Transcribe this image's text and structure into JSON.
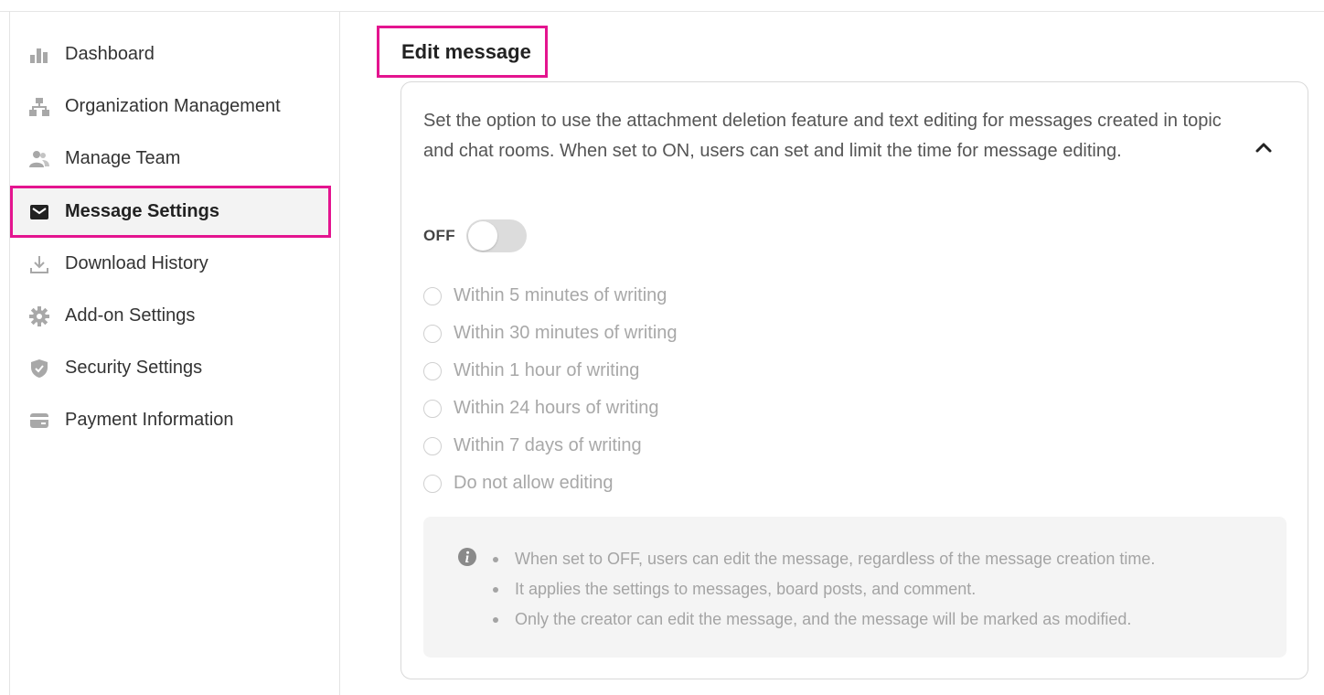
{
  "sidebar": {
    "items": [
      {
        "label": "Dashboard",
        "icon": "bar-chart-icon",
        "active": false
      },
      {
        "label": "Organization Management",
        "icon": "org-chart-icon",
        "active": false
      },
      {
        "label": "Manage Team",
        "icon": "team-icon",
        "active": false
      },
      {
        "label": "Message Settings",
        "icon": "envelope-icon",
        "active": true
      },
      {
        "label": "Download History",
        "icon": "download-icon",
        "active": false
      },
      {
        "label": "Add-on Settings",
        "icon": "gear-icon",
        "active": false
      },
      {
        "label": "Security Settings",
        "icon": "shield-icon",
        "active": false
      },
      {
        "label": "Payment Information",
        "icon": "credit-card-icon",
        "active": false
      }
    ]
  },
  "main": {
    "section_title": "Edit message",
    "description": "Set the option to use the attachment deletion feature and text editing for messages created in topic and chat rooms. When set to ON, users can set and limit the time for message editing.",
    "toggle": {
      "label": "OFF",
      "checked": false
    },
    "options": [
      {
        "label": "Within 5 minutes of writing"
      },
      {
        "label": "Within 30 minutes of writing"
      },
      {
        "label": "Within 1 hour of writing"
      },
      {
        "label": "Within 24 hours of writing"
      },
      {
        "label": "Within 7 days of writing"
      },
      {
        "label": "Do not allow editing"
      }
    ],
    "info": [
      "When set to OFF, users can edit the message, regardless of the message creation time.",
      "It applies the settings to messages, board posts, and comment.",
      "Only the creator can edit the message, and the message will be marked as modified."
    ]
  },
  "colors": {
    "highlight": "#e4148f",
    "icon": "#a8a8a8",
    "active_icon": "#222222",
    "disabled_text": "#a8a8a8"
  }
}
